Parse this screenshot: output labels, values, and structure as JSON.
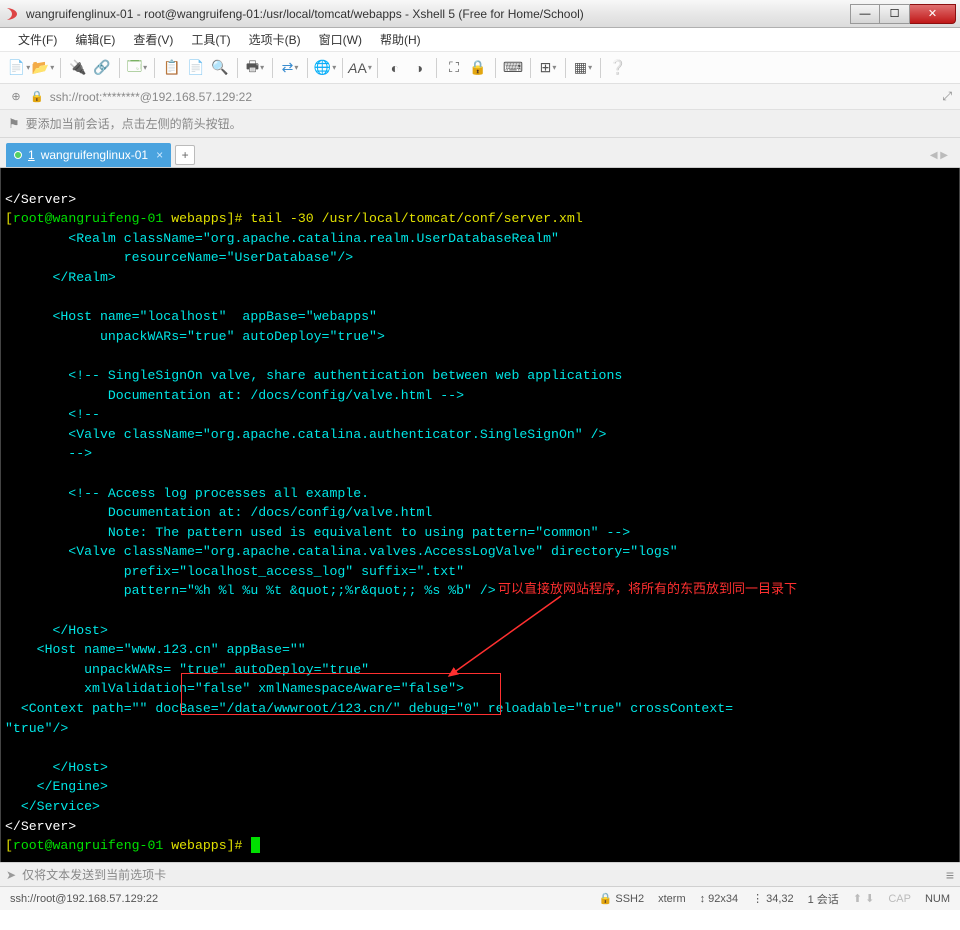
{
  "window": {
    "title": "wangruifenglinux-01 - root@wangruifeng-01:/usr/local/tomcat/webapps - Xshell 5 (Free for Home/School)"
  },
  "menu": {
    "file": "文件(F)",
    "edit": "编辑(E)",
    "view": "查看(V)",
    "tools": "工具(T)",
    "tabs": "选项卡(B)",
    "window": "窗口(W)",
    "help": "帮助(H)"
  },
  "address": {
    "text": "ssh://root:********@192.168.57.129:22"
  },
  "info": {
    "text": "要添加当前会话，点击左侧的箭头按钮。"
  },
  "tab": {
    "num": "1",
    "label": "wangruifenglinux-01",
    "close": "×",
    "add": "+"
  },
  "terminal": {
    "l1": "</Server>",
    "l2a": "[",
    "l2b": "root@wangruifeng-01",
    "l2c": " webapps",
    "l2d": "]# tail -30 /usr/local/tomcat/conf/server.xml",
    "l3": "        <Realm className=\"org.apache.catalina.realm.UserDatabaseRealm\"",
    "l4": "               resourceName=\"UserDatabase\"/>",
    "l5": "      </Realm>",
    "l6": " ",
    "l7": "      <Host name=\"localhost\"  appBase=\"webapps\"",
    "l8": "            unpackWARs=\"true\" autoDeploy=\"true\">",
    "l9": " ",
    "l10": "        <!-- SingleSignOn valve, share authentication between web applications",
    "l11": "             Documentation at: /docs/config/valve.html -->",
    "l12": "        <!--",
    "l13": "        <Valve className=\"org.apache.catalina.authenticator.SingleSignOn\" />",
    "l14": "        -->",
    "l15": " ",
    "l16": "        <!-- Access log processes all example.",
    "l17": "             Documentation at: /docs/config/valve.html",
    "l18": "             Note: The pattern used is equivalent to using pattern=\"common\" -->",
    "l19": "        <Valve className=\"org.apache.catalina.valves.AccessLogValve\" directory=\"logs\"",
    "l20": "               prefix=\"localhost_access_log\" suffix=\".txt\"",
    "l21": "               pattern=\"%h %l %u %t &quot;;%r&quot;; %s %b\" />",
    "l22": " ",
    "l23": "      </Host>",
    "l24": "    <Host name=\"www.123.cn\" appBase=\"\"",
    "l25": "          unpackWARs= \"true\" autoDeploy=\"true\"",
    "l26": "          xmlValidation=\"false\" xmlNamespaceAware=\"false\">",
    "l27": "  <Context path=\"\" docBase=\"/data/wwwroot/123.cn/\" debug=\"0\" reloadable=\"true\" crossContext=",
    "l28": "\"true\"/>",
    "l29": " ",
    "l30": "      </Host>",
    "l31": "    </Engine>",
    "l32": "  </Service>",
    "l33": "</Server>",
    "l34a": "[",
    "l34b": "root@wangruifeng-01",
    "l34c": " webapps",
    "l34d": "]# "
  },
  "annotation": {
    "text": "可以直接放网站程序，将所有的东西放到同一目录下"
  },
  "sendbar": {
    "text": "仅将文本发送到当前选项卡"
  },
  "status": {
    "conn": "ssh://root@192.168.57.129:22",
    "ssh": "SSH2",
    "term": "xterm",
    "size": "92x34",
    "pos": "34,32",
    "sessions": "1 会话",
    "cap": "CAP",
    "num": "NUM"
  }
}
